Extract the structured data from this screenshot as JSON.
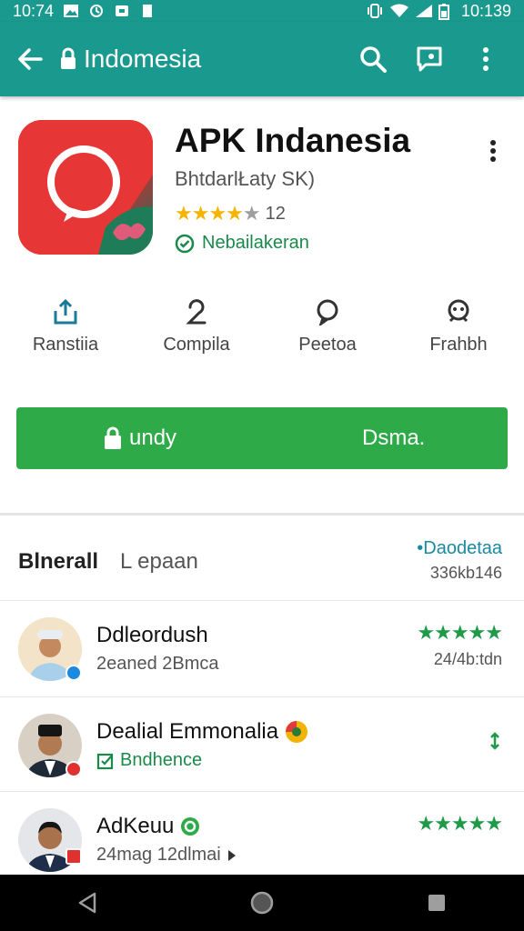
{
  "status_bar": {
    "time_left": "10:74",
    "time_right": "10:139"
  },
  "app_bar": {
    "title": "Indomesia"
  },
  "app": {
    "name": "APK Indanesia",
    "developer": "BhtdarlŁаty SK)",
    "rating_count": "12",
    "rating_stars": 4,
    "verified_label": "Nebailakeran",
    "colors": {
      "accent": "#1a9a8e",
      "install": "#2eaa48",
      "star": "#f4b400",
      "verified": "#1a8a4a"
    }
  },
  "actions": [
    {
      "label": "Ranstiia",
      "icon": "share-icon"
    },
    {
      "label": "Compila",
      "icon": "person-icon"
    },
    {
      "label": "Peetoa",
      "icon": "chat-bubble-icon"
    },
    {
      "label": "Frahbh",
      "icon": "face-icon"
    }
  ],
  "install": {
    "left_label": "undy",
    "right_label": "Dsma."
  },
  "reviews": {
    "tab_active": "Blnerall",
    "tab_other": "L epaan",
    "link": "•Daodetaa",
    "count": "336kb146",
    "items": [
      {
        "name": "Ddleordush",
        "sub": "2eaned 2Bmca",
        "stars": "★★★★★",
        "date": "24/4b:tdn"
      },
      {
        "name": "Dealial Emmonalia",
        "sub": "Bndhence",
        "stars": "",
        "date": ""
      },
      {
        "name": "AdKeuu",
        "sub": "24mag 12dlmai",
        "stars": "★★★★★",
        "date": ""
      }
    ]
  }
}
